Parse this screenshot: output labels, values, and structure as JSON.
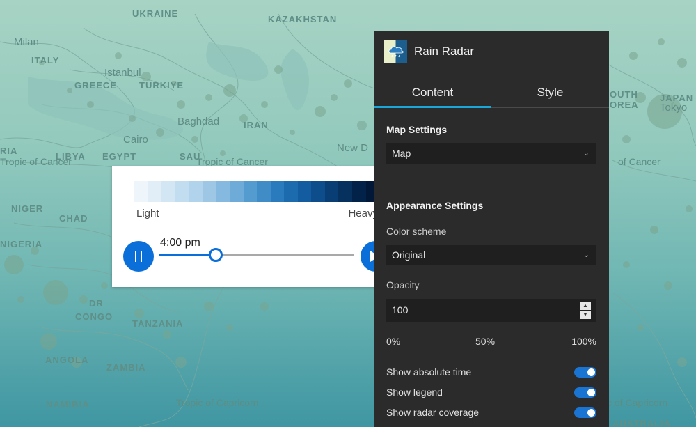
{
  "map": {
    "labels": {
      "ukraine": "UKRAINE",
      "kazakhstan": "KAZAKHSTAN",
      "milan": "Milan",
      "italy": "ITALY",
      "istanbul": "Istanbul",
      "greece": "GREECE",
      "turkiye": "TÜRKIYE",
      "iran": "IRAN",
      "baghdad": "Baghdad",
      "cairo": "Cairo",
      "libya": "LIBYA",
      "egypt": "EGYPT",
      "saudi": "SAU",
      "new_delhi": "New D",
      "tropic_cancer_w": "Tropic of Cancer",
      "tropic_cancer_m": "Tropic of Cancer",
      "tropic_cancer_e": "of Cancer",
      "south_korea_1": "OUTH",
      "south_korea_2": "OREA",
      "japan": "JAPAN",
      "tokyo": "Tokyo",
      "ria": "RIA",
      "niger": "NIGER",
      "chad": "CHAD",
      "nigeria": "NIGERIA",
      "dr": "DR",
      "congo": "CONGO",
      "tanzania": "TANZANIA",
      "angola": "ANGOLA",
      "zambia": "ZAMBIA",
      "namibia": "NAMIBIA",
      "tropic_capricorn_m": "Tropic of Capricorn",
      "tropic_capricorn_e": "c of Capricorn",
      "australia": "AUSTRALIA"
    }
  },
  "player": {
    "ramp_colors": [
      "#eef5fb",
      "#e1eef8",
      "#d2e6f4",
      "#c3ddf0",
      "#b1d3ec",
      "#9ec7e6",
      "#86b9e0",
      "#6eabd9",
      "#549bd0",
      "#3f8cc7",
      "#2a7bbd",
      "#1d6baf",
      "#135c9f",
      "#0d4d8b",
      "#093e75",
      "#06305e",
      "#03224a",
      "#021838"
    ],
    "label_light": "Light",
    "label_heavy": "Heavy",
    "time": "4:00 pm",
    "progress": 0.29,
    "accent": "#0a6fd8"
  },
  "panel": {
    "title": "Rain Radar",
    "tabs": [
      "Content",
      "Style"
    ],
    "active_tab": "Content",
    "map_settings": {
      "title": "Map Settings",
      "map_value": "Map"
    },
    "appearance": {
      "title": "Appearance Settings",
      "color_scheme_label": "Color scheme",
      "color_scheme_value": "Original",
      "opacity_label": "Opacity",
      "opacity_value": "100",
      "scale_min": "0%",
      "scale_mid": "50%",
      "scale_max": "100%"
    },
    "toggles": [
      {
        "label": "Show absolute time",
        "on": true
      },
      {
        "label": "Show legend",
        "on": true
      },
      {
        "label": "Show radar coverage",
        "on": true
      }
    ]
  }
}
